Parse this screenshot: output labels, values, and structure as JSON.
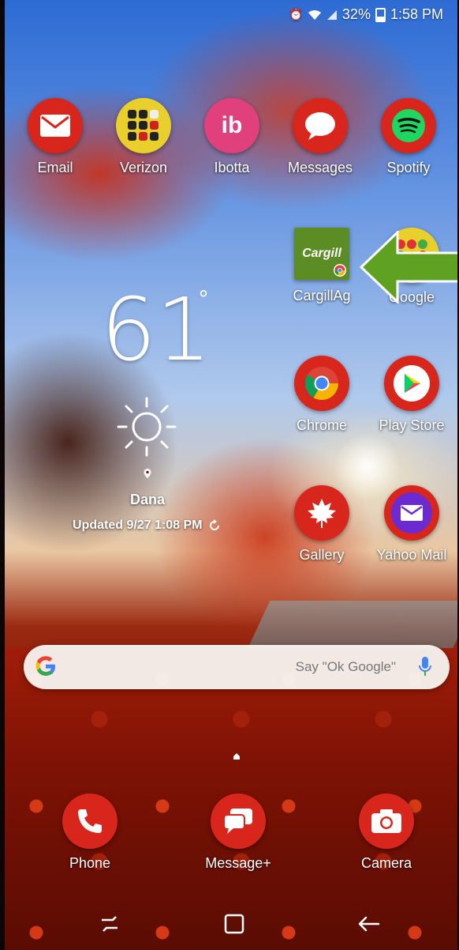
{
  "status_bar": {
    "battery": "32%",
    "time": "1:58 PM"
  },
  "apps_row1": [
    {
      "label": "Email"
    },
    {
      "label": "Verizon"
    },
    {
      "label": "Ibotta",
      "icon_text": "ib"
    },
    {
      "label": "Messages"
    },
    {
      "label": "Spotify"
    }
  ],
  "apps_row2": [
    {
      "label": "CargillAg",
      "icon_text": "Cargill"
    },
    {
      "label": "Google"
    }
  ],
  "apps_row3": [
    {
      "label": "Chrome"
    },
    {
      "label": "Play Store"
    }
  ],
  "apps_row4": [
    {
      "label": "Gallery"
    },
    {
      "label": "Yahoo Mail"
    }
  ],
  "weather": {
    "temp": "61",
    "degree": "°",
    "location": "Dana",
    "updated": "Updated 9/27 1:08 PM"
  },
  "search": {
    "placeholder": "Say \"Ok Google\""
  },
  "dock": [
    {
      "label": "Phone"
    },
    {
      "label": "Message+"
    },
    {
      "label": "Camera"
    }
  ],
  "colors": {
    "accent_red": "#d8261c",
    "cargill_green": "#5c8d25",
    "arrow_green": "#5fa121"
  }
}
